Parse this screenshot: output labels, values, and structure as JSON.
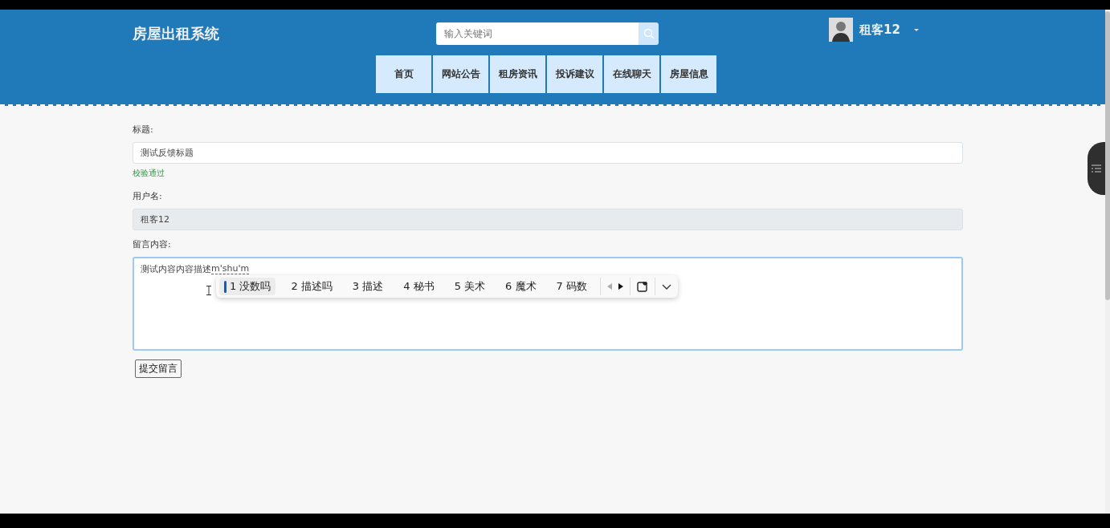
{
  "header": {
    "title": "房屋出租系统",
    "search": {
      "placeholder": "输入关键词"
    },
    "user": {
      "name": "租客12"
    }
  },
  "nav": [
    {
      "label": "首页"
    },
    {
      "label": "网站公告"
    },
    {
      "label": "租房资讯"
    },
    {
      "label": "投诉建议"
    },
    {
      "label": "在线聊天"
    },
    {
      "label": "房屋信息"
    }
  ],
  "form": {
    "fields": [
      {
        "kind": "input",
        "label": "标题:",
        "value": "测试反馈标题",
        "hint": "校验通过"
      },
      {
        "kind": "readonly",
        "label": "用户名:",
        "value": "租客12"
      },
      {
        "kind": "textarea",
        "label": "留言内容:",
        "value": "测试内容内容描述",
        "composition": "m'shu'm"
      }
    ],
    "submit": "提交留言"
  },
  "ime": {
    "candidates": [
      {
        "index": "1",
        "text": "没数吗",
        "selected": true
      },
      {
        "index": "2",
        "text": "描述吗",
        "selected": false
      },
      {
        "index": "3",
        "text": "描述",
        "selected": false
      },
      {
        "index": "4",
        "text": "秘书",
        "selected": false
      },
      {
        "index": "5",
        "text": "美术",
        "selected": false
      },
      {
        "index": "6",
        "text": "魔术",
        "selected": false
      },
      {
        "index": "7",
        "text": "码数",
        "selected": false
      }
    ]
  }
}
